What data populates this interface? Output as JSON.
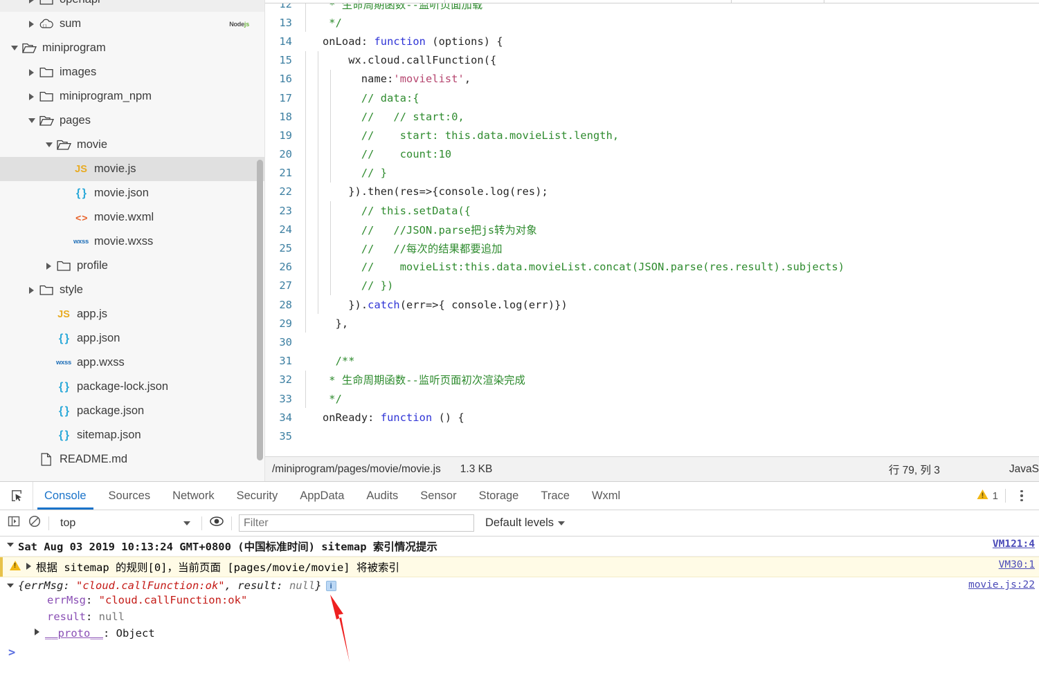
{
  "explorer": {
    "name": "file-explorer",
    "items": [
      {
        "label": "openapi",
        "indent": 1,
        "twisty": "closed",
        "icon": "folder-icon",
        "partial": true
      },
      {
        "label": "sum",
        "indent": 1,
        "twisty": "closed",
        "icon": "cloud-function-icon",
        "badge": "Node",
        "badge_suffix": "js"
      },
      {
        "label": "miniprogram",
        "indent": 0,
        "twisty": "open",
        "icon": "folder-open-icon"
      },
      {
        "label": "images",
        "indent": 1,
        "twisty": "closed",
        "icon": "folder-icon"
      },
      {
        "label": "miniprogram_npm",
        "indent": 1,
        "twisty": "closed",
        "icon": "folder-icon"
      },
      {
        "label": "pages",
        "indent": 1,
        "twisty": "open",
        "icon": "folder-open-icon"
      },
      {
        "label": "movie",
        "indent": 2,
        "twisty": "open",
        "icon": "folder-open-icon"
      },
      {
        "label": "movie.js",
        "indent": 3,
        "twisty": "none",
        "icon": "js-file-icon",
        "selected": true
      },
      {
        "label": "movie.json",
        "indent": 3,
        "twisty": "none",
        "icon": "json-file-icon"
      },
      {
        "label": "movie.wxml",
        "indent": 3,
        "twisty": "none",
        "icon": "wxml-file-icon"
      },
      {
        "label": "movie.wxss",
        "indent": 3,
        "twisty": "none",
        "icon": "wxss-file-icon"
      },
      {
        "label": "profile",
        "indent": 2,
        "twisty": "closed",
        "icon": "folder-icon"
      },
      {
        "label": "style",
        "indent": 1,
        "twisty": "closed",
        "icon": "folder-icon"
      },
      {
        "label": "app.js",
        "indent": 2,
        "twisty": "none",
        "icon": "js-file-icon"
      },
      {
        "label": "app.json",
        "indent": 2,
        "twisty": "none",
        "icon": "json-file-icon"
      },
      {
        "label": "app.wxss",
        "indent": 2,
        "twisty": "none",
        "icon": "wxss-file-icon"
      },
      {
        "label": "package-lock.json",
        "indent": 2,
        "twisty": "none",
        "icon": "json-file-icon"
      },
      {
        "label": "package.json",
        "indent": 2,
        "twisty": "none",
        "icon": "json-file-icon"
      },
      {
        "label": "sitemap.json",
        "indent": 2,
        "twisty": "none",
        "icon": "json-file-icon"
      },
      {
        "label": "README.md",
        "indent": 1,
        "twisty": "none",
        "icon": "md-file-icon"
      }
    ]
  },
  "editor": {
    "first_line": 12,
    "lines": [
      {
        "n": 12,
        "guides": [
          0
        ],
        "tokens": [
          {
            "t": " * 生命周期函数--监听页面加载",
            "c": "cmt"
          }
        ]
      },
      {
        "n": 13,
        "guides": [
          0
        ],
        "tokens": [
          {
            "t": " */",
            "c": "cmt"
          }
        ]
      },
      {
        "n": 14,
        "guides": [],
        "tokens": [
          {
            "t": "onLoad: ",
            "c": "pl"
          },
          {
            "t": "function",
            "c": "kw"
          },
          {
            "t": " (options) {",
            "c": "pl"
          }
        ]
      },
      {
        "n": 15,
        "guides": [
          0,
          1
        ],
        "tokens": [
          {
            "t": "    wx.cloud.callFunction({",
            "c": "pl"
          }
        ]
      },
      {
        "n": 16,
        "guides": [
          0,
          1,
          2
        ],
        "tokens": [
          {
            "t": "      name:",
            "c": "pl"
          },
          {
            "t": "'movielist'",
            "c": "str"
          },
          {
            "t": ",",
            "c": "pl"
          }
        ]
      },
      {
        "n": 17,
        "guides": [
          0,
          1,
          2
        ],
        "tokens": [
          {
            "t": "      // data:{",
            "c": "cmt"
          }
        ]
      },
      {
        "n": 18,
        "guides": [
          0,
          1,
          2
        ],
        "tokens": [
          {
            "t": "      //   // start:0,",
            "c": "cmt"
          }
        ]
      },
      {
        "n": 19,
        "guides": [
          0,
          1,
          2
        ],
        "tokens": [
          {
            "t": "      //    start: this.data.movieList.length,",
            "c": "cmt"
          }
        ]
      },
      {
        "n": 20,
        "guides": [
          0,
          1,
          2
        ],
        "tokens": [
          {
            "t": "      //    count:10",
            "c": "cmt"
          }
        ]
      },
      {
        "n": 21,
        "guides": [
          0,
          1,
          2
        ],
        "tokens": [
          {
            "t": "      // }",
            "c": "cmt"
          }
        ]
      },
      {
        "n": 22,
        "guides": [
          0,
          1
        ],
        "tokens": [
          {
            "t": "    }).then(res=>{console.log(res);",
            "c": "pl"
          }
        ]
      },
      {
        "n": 23,
        "guides": [
          0,
          1,
          2
        ],
        "tokens": [
          {
            "t": "      // this.setData({",
            "c": "cmt"
          }
        ]
      },
      {
        "n": 24,
        "guides": [
          0,
          1,
          2
        ],
        "tokens": [
          {
            "t": "      //   //JSON.parse把js转为对象",
            "c": "cmt"
          }
        ]
      },
      {
        "n": 25,
        "guides": [
          0,
          1,
          2
        ],
        "tokens": [
          {
            "t": "      //   //每次的结果都要追加",
            "c": "cmt"
          }
        ]
      },
      {
        "n": 26,
        "guides": [
          0,
          1,
          2
        ],
        "tokens": [
          {
            "t": "      //    movieList:this.data.movieList.concat(JSON.parse(res.result).subjects)",
            "c": "cmt"
          }
        ]
      },
      {
        "n": 27,
        "guides": [
          0,
          1,
          2
        ],
        "tokens": [
          {
            "t": "      // })",
            "c": "cmt"
          }
        ]
      },
      {
        "n": 28,
        "guides": [
          0,
          1
        ],
        "tokens": [
          {
            "t": "    }).",
            "c": "pl"
          },
          {
            "t": "catch",
            "c": "kw"
          },
          {
            "t": "(err=>{ console.log(err)})",
            "c": "pl"
          }
        ]
      },
      {
        "n": 29,
        "guides": [
          0
        ],
        "tokens": [
          {
            "t": "  },",
            "c": "pl"
          }
        ]
      },
      {
        "n": 30,
        "guides": [],
        "tokens": [
          {
            "t": "",
            "c": "pl"
          }
        ]
      },
      {
        "n": 31,
        "guides": [],
        "tokens": [
          {
            "t": "  /**",
            "c": "cmt"
          }
        ]
      },
      {
        "n": 32,
        "guides": [
          0
        ],
        "tokens": [
          {
            "t": " * 生命周期函数--监听页面初次渲染完成",
            "c": "cmt"
          }
        ]
      },
      {
        "n": 33,
        "guides": [
          0
        ],
        "tokens": [
          {
            "t": " */",
            "c": "cmt"
          }
        ]
      },
      {
        "n": 34,
        "guides": [],
        "tokens": [
          {
            "t": "onReady: ",
            "c": "pl"
          },
          {
            "t": "function",
            "c": "kw"
          },
          {
            "t": " () {",
            "c": "pl"
          }
        ]
      },
      {
        "n": 35,
        "guides": [],
        "tokens": [
          {
            "t": "",
            "c": "pl"
          }
        ]
      }
    ],
    "statusbar": {
      "path": "/miniprogram/pages/movie/movie.js",
      "size": "1.3 KB",
      "position": "行 79, 列 3",
      "language": "JavaS"
    }
  },
  "devtools": {
    "inspect_icon": "inspect-element-icon",
    "tabs": [
      {
        "label": "Console",
        "active": true
      },
      {
        "label": "Sources",
        "active": false
      },
      {
        "label": "Network",
        "active": false
      },
      {
        "label": "Security",
        "active": false
      },
      {
        "label": "AppData",
        "active": false
      },
      {
        "label": "Audits",
        "active": false
      },
      {
        "label": "Sensor",
        "active": false
      },
      {
        "label": "Storage",
        "active": false
      },
      {
        "label": "Trace",
        "active": false
      },
      {
        "label": "Wxml",
        "active": false
      }
    ],
    "warning_count": "1",
    "toolbar": {
      "sidebar_icon": "show-console-sidebar-icon",
      "clear_icon": "clear-console-icon",
      "context": "top",
      "eye_icon": "live-expression-icon",
      "filter_placeholder": "Filter",
      "filter_value": "",
      "levels_label": "Default levels"
    },
    "messages": [
      {
        "kind": "group",
        "text": "Sat Aug 03 2019 10:13:24 GMT+0800 (中国标准时间) sitemap 索引情况提示",
        "source": "VM121:4"
      },
      {
        "kind": "warning",
        "text": "根据 sitemap 的规则[0]，当前页面 [pages/movie/movie] 将被索引",
        "source": "VM30:1"
      },
      {
        "kind": "object",
        "preview_prefix": "{errMsg: ",
        "preview_str": "\"cloud.callFunction:ok\"",
        "preview_mid": ", result: ",
        "preview_null": "null",
        "preview_suffix": "}",
        "info_badge": "i",
        "source": "movie.js:22",
        "props": [
          {
            "key": "errMsg",
            "sep": ": ",
            "value": "\"cloud.callFunction:ok\"",
            "type": "string"
          },
          {
            "key": "result",
            "sep": ": ",
            "value": "null",
            "type": "null"
          },
          {
            "key": "__proto__",
            "sep": ": ",
            "value": "Object",
            "type": "object",
            "expandable": true
          }
        ]
      }
    ],
    "prompt_caret": ">"
  },
  "annotation": {
    "arrow": "red-annotation-arrow",
    "color": "#ee2020"
  }
}
